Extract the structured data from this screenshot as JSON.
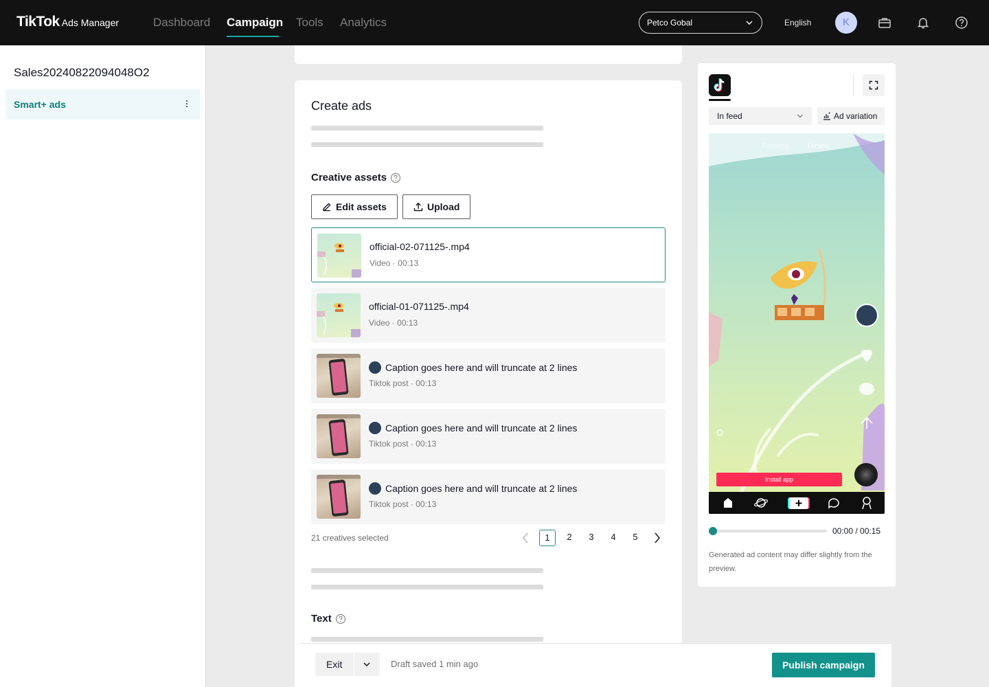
{
  "header": {
    "logo_brand": "TikTok",
    "logo_product": "Ads Manager",
    "nav": [
      {
        "label": "Dashboard",
        "active": false
      },
      {
        "label": "Campaign",
        "active": true
      },
      {
        "label": "Tools",
        "active": false
      },
      {
        "label": "Analytics",
        "active": false
      }
    ],
    "account": "Petco Gobal",
    "language": "English",
    "avatar_initial": "K",
    "icons": [
      "briefcase-icon",
      "bell-icon",
      "help-icon"
    ]
  },
  "sidebar": {
    "campaign_name": "Sales20240822094048O2",
    "items": [
      {
        "label": "Smart+ ads",
        "active": true
      }
    ]
  },
  "create_ads": {
    "title": "Create ads",
    "creative_assets": {
      "title": "Creative assets",
      "edit_label": "Edit assets",
      "upload_label": "Upload",
      "items": [
        {
          "name": "official-02-071125-.mp4",
          "meta": "Video · 00:13",
          "kind": "video",
          "selected": true
        },
        {
          "name": "official-01-071125-.mp4",
          "meta": "Video · 00:13",
          "kind": "video",
          "selected": false
        },
        {
          "name": "Caption goes here and will truncate at 2 lines",
          "meta": "Tiktok post · 00:13",
          "kind": "post",
          "selected": false
        },
        {
          "name": "Caption goes here and will truncate at 2 lines",
          "meta": "Tiktok post · 00:13",
          "kind": "post",
          "selected": false
        },
        {
          "name": "Caption goes here and will truncate at 2 lines",
          "meta": "Tiktok post · 00:13",
          "kind": "post",
          "selected": false
        }
      ],
      "selected_count": "21 creatives selected",
      "pages": [
        "1",
        "2",
        "3",
        "4",
        "5"
      ],
      "current_page": "1"
    },
    "text_section": {
      "title": "Text"
    }
  },
  "footer": {
    "exit_label": "Exit",
    "draft_status": "Draft saved 1 min ago",
    "publish_label": "Publish campaign"
  },
  "preview": {
    "placement": "In feed",
    "ad_variation_label": "Ad variation",
    "phone": {
      "tab_following": "Following",
      "tab_for_you": "For you",
      "cta": "Install app"
    },
    "time": "00:00 / 00:15",
    "progress": 0,
    "disclaimer": "Generated ad content may differ slightly from the preview."
  },
  "colors": {
    "brand_teal": "#13928c",
    "topbar": "#121212",
    "cta_red": "#fe2c55"
  }
}
